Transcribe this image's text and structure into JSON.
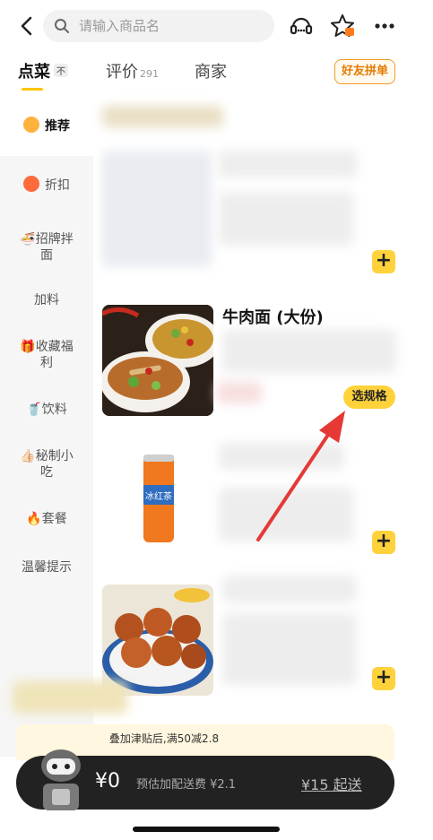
{
  "header": {
    "search_placeholder": "请输入商品名",
    "icons": [
      "back-icon",
      "search-icon",
      "customer-service-icon",
      "favorite-star-icon",
      "more-icon"
    ]
  },
  "tabs": {
    "order": {
      "label": "点菜",
      "badge": "不"
    },
    "reviews": {
      "label": "评价",
      "count": "291"
    },
    "merchant": {
      "label": "商家"
    }
  },
  "group_order_label": "好友拼单",
  "sidebar": {
    "items": [
      {
        "label": "推荐",
        "icon": "recommend-icon"
      },
      {
        "label": "折扣",
        "icon": "discount-icon"
      },
      {
        "label": "🍜招牌拌面"
      },
      {
        "label": "加料"
      },
      {
        "label": "🎁收藏福利"
      },
      {
        "label": "🥤饮料"
      },
      {
        "label": "👍🏻秘制小吃"
      },
      {
        "label": "🔥套餐"
      },
      {
        "label": "温馨提示"
      }
    ]
  },
  "products": {
    "beef_noodle": {
      "name": "牛肉面 (大份)",
      "action": "选规格"
    },
    "add_symbol": "+",
    "drink_can_text": "冰红茶"
  },
  "bottom": {
    "promo_text": "叠加津贴后,满50减2.8",
    "cart_total": "¥0",
    "delivery_fee": "预估加配送费 ¥2.1",
    "min_order": "¥15 起送"
  },
  "colors": {
    "accent_yellow": "#ffd23c",
    "group_button_orange": "#f59a23",
    "cart_bar": "#222222",
    "arrow_red": "#e53935"
  }
}
